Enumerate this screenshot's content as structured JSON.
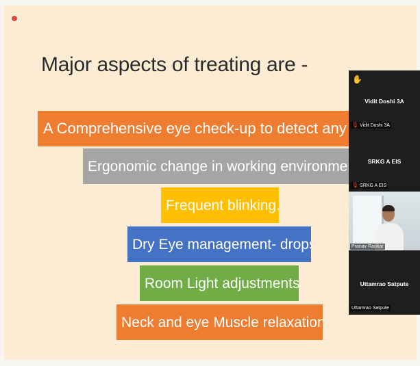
{
  "slide": {
    "title": "Major aspects of treating are -",
    "bullets": [
      "A Comprehensive eye check-up to detect any other",
      "Ergonomic change in working environment.",
      "Frequent blinking.",
      "Dry Eye management- drops.",
      "Room Light adjustments.",
      "Neck and eye Muscle relaxation."
    ],
    "colors": [
      "#ee7d31",
      "#a5a5a5",
      "#ffbf00",
      "#4472c4",
      "#70ad47",
      "#ee7d31"
    ]
  },
  "participants": [
    {
      "display_name": "Vidit Doshi 3A",
      "label": "Vidit Doshi 3A",
      "hand_raised": true,
      "muted": true
    },
    {
      "display_name": "SRKG A EIS",
      "label": "SRKG A EIS",
      "muted": true
    },
    {
      "display_name": "",
      "label": "Pranav Raokar",
      "video": true
    },
    {
      "display_name": "Uttamrao Satpute",
      "label": "Uttamrao Satpute"
    }
  ],
  "icons": {
    "recording": "record-icon",
    "hand": "raised-hand-icon",
    "mic": "mic-muted-icon"
  }
}
